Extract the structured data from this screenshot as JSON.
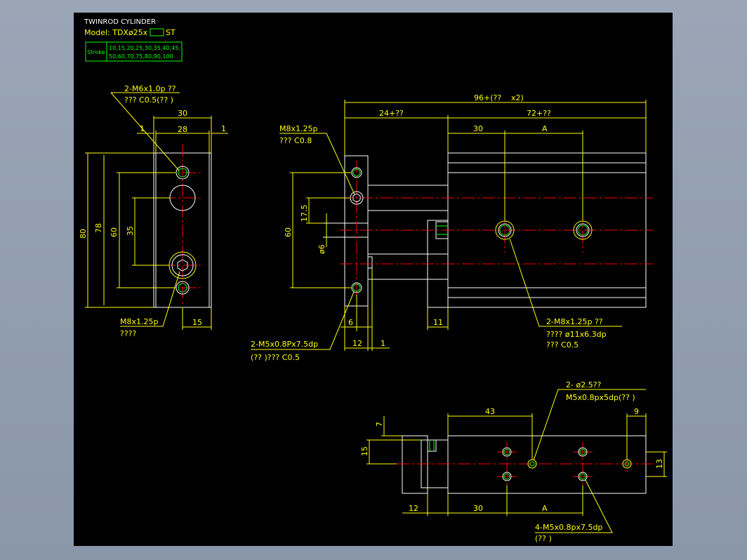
{
  "title_block": {
    "title": "TWINROD CYLINDER",
    "model_prefix": "Model: TDXø25x",
    "model_suffix": "ST",
    "stroke_label": "Stroke",
    "stroke_values_1": "10,15,20,25,30,35,40,45,",
    "stroke_values_2": "50,60,70,75,80,90,100"
  },
  "front_view": {
    "thread_callout_1": "2-M6x1.0p ??",
    "thread_callout_2": "???  C0.5(??  )",
    "dim_30": "30",
    "dim_28": "28",
    "dim_1_left": "1",
    "dim_1_right": "1",
    "dim_80": "80",
    "dim_78": "78",
    "dim_60": "60",
    "dim_35": "35",
    "bolt_callout_1": "M8x1.25p",
    "bolt_callout_2": "????",
    "dim_15": "15"
  },
  "side_view": {
    "overall_1": "96+(??",
    "overall_2": "x2)",
    "dim_24": "24+??",
    "dim_72": "72+??",
    "dim_30": "30",
    "dim_A": "A",
    "bolt_callout_1": "M8x1.25p",
    "bolt_callout_2": "???   C0.8",
    "dim_60": "60",
    "dim_17_5": "17.5",
    "dim_phi6": "ø6",
    "dim_6": "6",
    "dim_12": "12",
    "dim_1": "1",
    "dim_11": "11",
    "m5_callout_1": "2-M5x0.8Px7.5dp",
    "m5_callout_2": "(??  )???   C0.5",
    "m8_callout_1": "2-M8x1.25p ??",
    "m8_callout_2": "????     ø11x6.3dp",
    "m8_callout_3": "???    C0.5"
  },
  "top_view": {
    "pin_callout_1": "2- ø2.5??",
    "pin_callout_2": "M5x0.8px5dp(??  )",
    "dim_43": "43",
    "dim_9": "9",
    "dim_7": "7",
    "dim_15": "15",
    "dim_13": "13",
    "dim_12": "12",
    "dim_30": "30",
    "dim_A": "A",
    "m5_callout_1": "4-M5x0.8px7.5dp",
    "m5_callout_2": "(??  )"
  }
}
